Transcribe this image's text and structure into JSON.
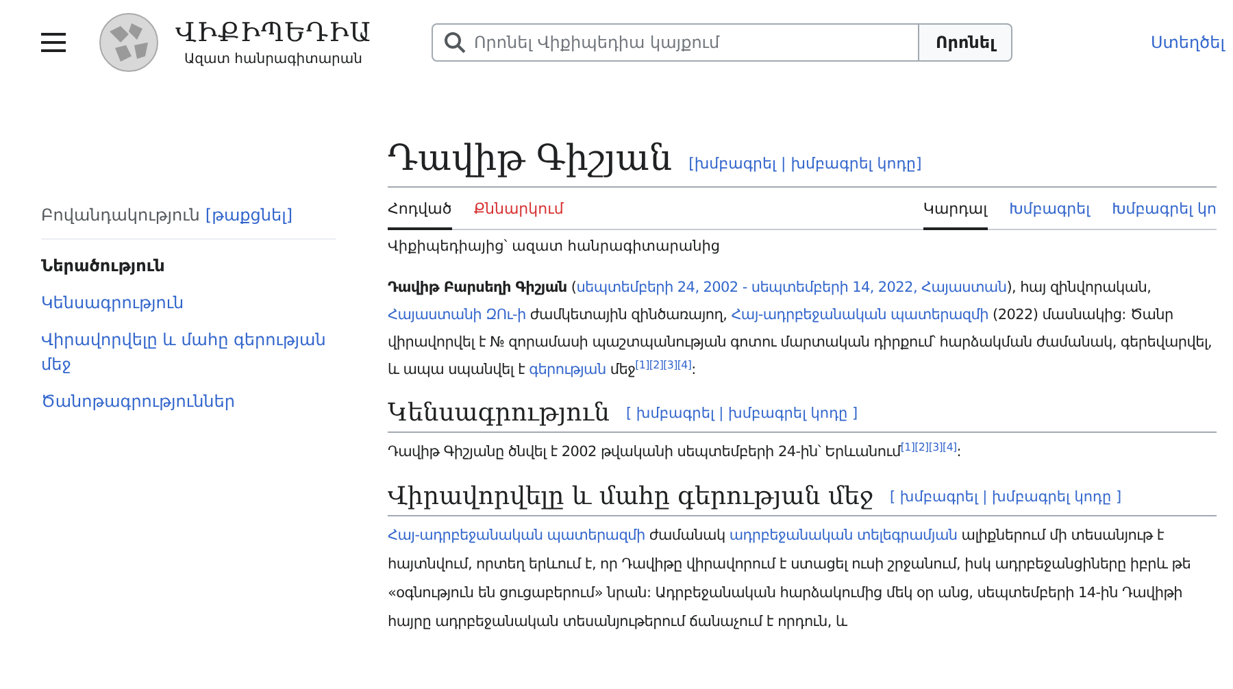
{
  "header": {
    "logo_title": "ՎԻՔԻՊԵԴԻԱ",
    "logo_tagline": "Ազատ հանրագիտարան",
    "search": {
      "placeholder": "Որոնել Վիքիպեդիա կայքում",
      "button": "Որոնել"
    },
    "user_link": "Ստեղծել"
  },
  "toc": {
    "title": "Բովանդակություն",
    "toggle": "[թաքցնել]",
    "items": [
      {
        "label": "Ներածություն",
        "selected": true
      },
      {
        "label": "Կենսագրություն",
        "selected": false
      },
      {
        "label": "Վիրավորվելը և մահը գերության մեջ",
        "selected": false
      },
      {
        "label": "Ծանոթագրություններ",
        "selected": false
      }
    ]
  },
  "article": {
    "title": "Դավիթ Գիշյան",
    "title_edit": "[խմբագրել | խմբագրել կոդը]",
    "left_tabs": [
      {
        "label": "Հոդված",
        "selected": true,
        "missing": false
      },
      {
        "label": "Քննարկում",
        "selected": false,
        "missing": true
      }
    ],
    "right_tabs": [
      {
        "label": "Կարդալ",
        "selected": true
      },
      {
        "label": "Խմբագրել",
        "selected": false
      },
      {
        "label": "Խմբագրել կո",
        "selected": false
      }
    ],
    "tagline": "Վիքիպեդիայից՝ ազատ հանրագիտարանից",
    "intro": [
      {
        "kind": "bold",
        "text": "Դավիթ Բարսեղի Գիշյան"
      },
      {
        "kind": "text",
        "text": " ("
      },
      {
        "kind": "link",
        "text": "սեպտեմբերի 24, 2002 - սեպտեմբերի 14, 2022, Հայաստան"
      },
      {
        "kind": "text",
        "text": "), հայ զինվորական, "
      },
      {
        "kind": "link",
        "text": "Հայաստանի ԶՈւ-ի"
      },
      {
        "kind": "text",
        "text": " ժամկետային զինծառայող, "
      },
      {
        "kind": "link",
        "text": "Հայ-ադրբեջանական պատերազմի"
      },
      {
        "kind": "text",
        "text": " (2022) մասնակից: Ծանր վիրավորվել է № զորամասի պաշտպանության գոտու մարտական դիրքում՝ հարձակման ժամանակ, գերեվարվել, և ապա սպանվել է "
      },
      {
        "kind": "link",
        "text": "գերության"
      },
      {
        "kind": "text",
        "text": " մեջ"
      },
      {
        "kind": "sup",
        "text": "[1][2][3][4]"
      },
      {
        "kind": "text",
        "text": ":"
      }
    ],
    "sections": [
      {
        "heading": "Կենսագրություն",
        "edit": "[ խմբագրել | խմբագրել կոդը ]",
        "paragraph": [
          {
            "kind": "text",
            "text": "Դավիթ Գիշյանը ծնվել է 2002 թվականի սեպտեմբերի 24-ին՝ Երևանում"
          },
          {
            "kind": "sup",
            "text": "[1][2][3][4]"
          },
          {
            "kind": "text",
            "text": ":"
          }
        ]
      },
      {
        "heading": "Վիրավորվելը և մահը գերության մեջ",
        "edit": "[ խմբագրել | խմբագրել կոդը ]",
        "paragraph": [
          {
            "kind": "link",
            "text": "Հայ-ադրբեջանական պատերազմի"
          },
          {
            "kind": "text",
            "text": " ժամանակ "
          },
          {
            "kind": "link",
            "text": "ադրբեջանական տելեգրամյան"
          },
          {
            "kind": "text",
            "text": " ալիքներում մի տեսանյութ է հայտնվում, որտեղ երևում է, որ Դավիթը վիրավորում է ստացել ուսի շրջանում, իսկ ադրբեջանցիները իբրև թե «օգնություն են ցուցաբերում» նրան: Ադրբեջանական հարձակումից մեկ օր անց, սեպտեմբերի 14-ին Դավիթի հայրը ադրբեջանական տեսանյութերում ճանաչում է որդուն, և"
          }
        ]
      }
    ]
  }
}
